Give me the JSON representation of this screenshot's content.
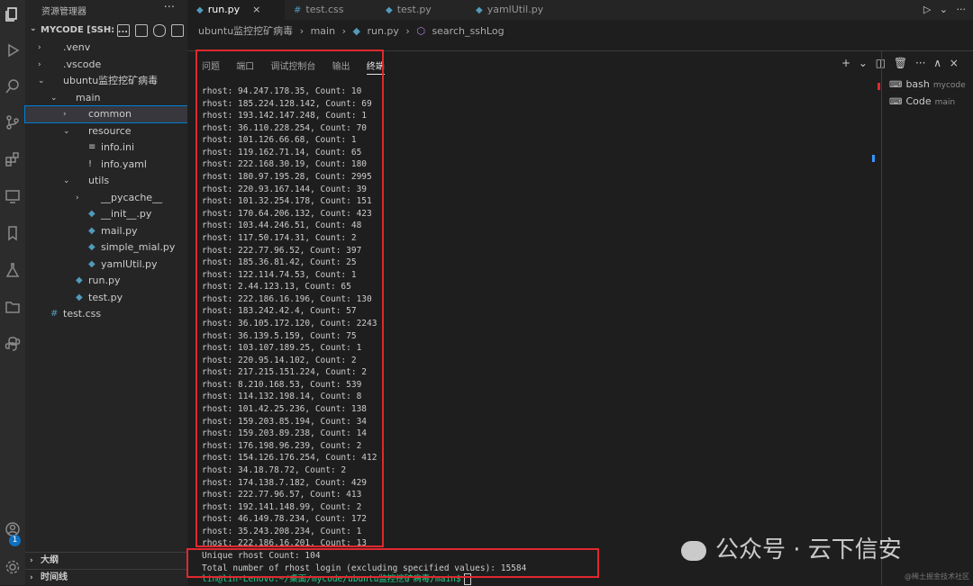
{
  "sidebar": {
    "header": "资源管理器",
    "more": "···",
    "workspace": "MYCODE [SSH: ...",
    "tree": [
      {
        "label": ".venv",
        "chev": "›",
        "icon": ""
      },
      {
        "label": ".vscode",
        "chev": "›",
        "icon": ""
      },
      {
        "label": "ubuntu监控挖矿病毒",
        "chev": "⌄",
        "icon": ""
      },
      {
        "label": "main",
        "chev": "⌄",
        "icon": ""
      },
      {
        "label": "common",
        "chev": "›",
        "icon": ""
      },
      {
        "label": "resource",
        "chev": "⌄",
        "icon": ""
      },
      {
        "label": "info.ini",
        "chev": "",
        "icon": "≡"
      },
      {
        "label": "info.yaml",
        "chev": "",
        "icon": "!"
      },
      {
        "label": "utils",
        "chev": "⌄",
        "icon": ""
      },
      {
        "label": "__pycache__",
        "chev": "›",
        "icon": ""
      },
      {
        "label": "__init__.py",
        "chev": "",
        "icon": "py"
      },
      {
        "label": "mail.py",
        "chev": "",
        "icon": "py"
      },
      {
        "label": "simple_mial.py",
        "chev": "",
        "icon": "py"
      },
      {
        "label": "yamlUtil.py",
        "chev": "",
        "icon": "py"
      },
      {
        "label": "run.py",
        "chev": "",
        "icon": "py"
      },
      {
        "label": "test.py",
        "chev": "",
        "icon": "py"
      },
      {
        "label": "test.css",
        "chev": "",
        "icon": "#"
      }
    ],
    "outline": "大纲",
    "timeline": "时间线"
  },
  "tabs": [
    {
      "label": "run.py",
      "close": "×"
    },
    {
      "label": "test.css"
    },
    {
      "label": "test.py"
    },
    {
      "label": "yamlUtil.py"
    }
  ],
  "tab_actions": "▷ ⌄ ···",
  "breadcrumb": [
    "ubuntu监控挖矿病毒",
    "›",
    "main",
    "›",
    "run.py",
    "›",
    "search_sshLog"
  ],
  "panel": {
    "tabs": [
      "问题",
      "端口",
      "调试控制台",
      "输出",
      "终端"
    ],
    "actions": "+ ⌄ ◫ 🗑 ··· ∧ ×"
  },
  "terminal": {
    "lines": [
      "rhost: 94.247.178.35, Count: 10",
      "rhost: 185.224.128.142, Count: 69",
      "rhost: 193.142.147.248, Count: 1",
      "rhost: 36.110.228.254, Count: 70",
      "rhost: 101.126.66.68, Count: 1",
      "rhost: 119.162.71.14, Count: 65",
      "rhost: 222.168.30.19, Count: 180",
      "rhost: 180.97.195.28, Count: 2995",
      "rhost: 220.93.167.144, Count: 39",
      "rhost: 101.32.254.178, Count: 151",
      "rhost: 170.64.206.132, Count: 423",
      "rhost: 103.44.246.51, Count: 48",
      "rhost: 117.50.174.31, Count: 2",
      "rhost: 222.77.96.52, Count: 397",
      "rhost: 185.36.81.42, Count: 25",
      "rhost: 122.114.74.53, Count: 1",
      "rhost: 2.44.123.13, Count: 65",
      "rhost: 222.186.16.196, Count: 130",
      "rhost: 183.242.42.4, Count: 57",
      "rhost: 36.105.172.120, Count: 2243",
      "rhost: 36.139.5.159, Count: 75",
      "rhost: 103.107.189.25, Count: 1",
      "rhost: 220.95.14.102, Count: 2",
      "rhost: 217.215.151.224, Count: 2",
      "rhost: 8.210.168.53, Count: 539",
      "rhost: 114.132.198.14, Count: 8",
      "rhost: 101.42.25.236, Count: 138",
      "rhost: 159.203.85.194, Count: 34",
      "rhost: 159.203.89.238, Count: 14",
      "rhost: 176.198.96.239, Count: 2",
      "rhost: 154.126.176.254, Count: 412",
      "rhost: 34.18.78.72, Count: 2",
      "rhost: 174.138.7.182, Count: 429",
      "rhost: 222.77.96.57, Count: 413",
      "rhost: 192.141.148.99, Count: 2",
      "rhost: 46.149.78.234, Count: 172",
      "rhost: 35.243.208.234, Count: 1",
      "rhost: 222.186.16.201, Count: 13",
      "Unique rhost Count: 104",
      "Total number of rhost login (excluding specified values): 15584"
    ],
    "prompt": "lin@lin-Lenovo:~/桌面/mycode/ubuntu监控挖矿病毒/main$"
  },
  "terminal_list": [
    {
      "name": "bash",
      "sub": "mycode"
    },
    {
      "name": "Code",
      "sub": "main"
    }
  ],
  "badge_count": "1",
  "watermark": "公众号 · 云下信安",
  "watermark_small": "@稀土掘金技术社区",
  "colors": {
    "red_highlight": "#e0282e",
    "prompt_green": "#23d18b",
    "accent_blue": "#007fd4"
  }
}
